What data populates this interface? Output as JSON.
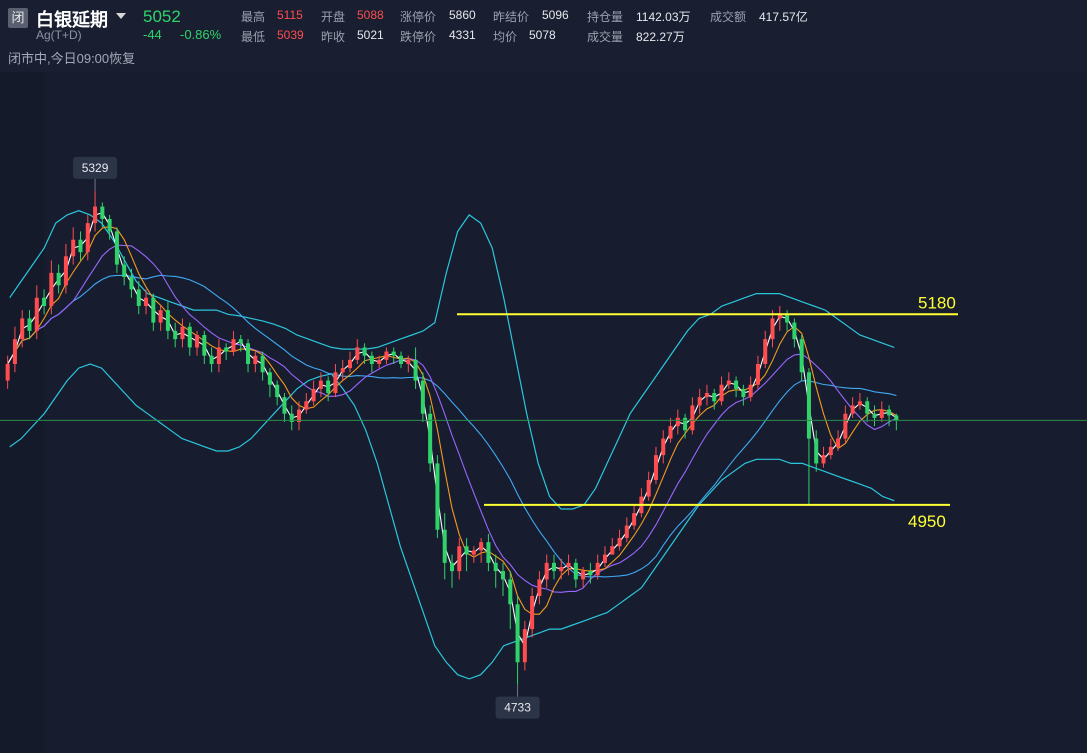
{
  "header": {
    "badge": "闭",
    "name": "白银延期",
    "code": "Ag(T+D)",
    "price": "5052",
    "change": "-44",
    "change_pct": "-0.86%",
    "status": "闭市中,今日09:00恢复",
    "colors": {
      "up": "#ff4d4f",
      "down": "#2fd36a",
      "bg": "#171d2e"
    },
    "icons": {
      "dropdown": "chevron-down-icon"
    }
  },
  "quotes": [
    {
      "label": "最高",
      "value": "5115",
      "color": "red"
    },
    {
      "label": "开盘",
      "value": "5088",
      "color": "red"
    },
    {
      "label": "涨停价",
      "value": "5860",
      "color": "white"
    },
    {
      "label": "昨结价",
      "value": "5096",
      "color": "white"
    },
    {
      "label": "持仓量",
      "value": "1142.03万",
      "color": "white"
    },
    {
      "label": "成交额",
      "value": "417.57亿",
      "color": "white"
    },
    {
      "label": "最低",
      "value": "5039",
      "color": "red"
    },
    {
      "label": "昨收",
      "value": "5021",
      "color": "white"
    },
    {
      "label": "跌停价",
      "value": "4331",
      "color": "white"
    },
    {
      "label": "均价",
      "value": "5078",
      "color": "white"
    },
    {
      "label": "成交量",
      "value": "822.27万",
      "color": "white"
    }
  ],
  "chart_data": {
    "type": "candlestick",
    "ylim": [
      4700,
      5400
    ],
    "grid": false,
    "high_marker": "5329",
    "low_marker": "4733",
    "horizontal_lines": [
      {
        "label": "5180",
        "value": 5180,
        "color": "#ffff33"
      },
      {
        "label": "4950",
        "value": 4950,
        "color": "#ffff33"
      }
    ],
    "reference_line": {
      "value": 5052,
      "color": "#2e8b4a"
    },
    "overlays": [
      "bollinger-upper",
      "bollinger-lower",
      "ma-white",
      "ma-orange",
      "ma-purple",
      "ma-blue"
    ],
    "series_colors": {
      "ma-white": "#ffffff",
      "ma-orange": "#f39a1e",
      "ma-purple": "#9966ff",
      "ma-blue": "#3fa9f5",
      "bollinger": "#2bc6dd"
    },
    "close": [
      5120,
      5150,
      5175,
      5160,
      5200,
      5190,
      5230,
      5215,
      5250,
      5270,
      5255,
      5290,
      5310,
      5295,
      5280,
      5240,
      5225,
      5210,
      5190,
      5200,
      5170,
      5185,
      5160,
      5150,
      5165,
      5140,
      5155,
      5130,
      5120,
      5140,
      5135,
      5150,
      5145,
      5120,
      5130,
      5110,
      5095,
      5080,
      5060,
      5050,
      5065,
      5075,
      5090,
      5100,
      5085,
      5110,
      5115,
      5125,
      5140,
      5130,
      5120,
      5125,
      5135,
      5130,
      5120,
      5125,
      5100,
      5060,
      5000,
      4920,
      4880,
      4870,
      4900,
      4890,
      4895,
      4905,
      4880,
      4870,
      4860,
      4830,
      4760,
      4800,
      4840,
      4860,
      4880,
      4870,
      4875,
      4880,
      4860,
      4870,
      4865,
      4880,
      4890,
      4900,
      4910,
      4925,
      4940,
      4960,
      4980,
      5010,
      5030,
      5045,
      5055,
      5040,
      5070,
      5080,
      5085,
      5075,
      5095,
      5100,
      5090,
      5080,
      5095,
      5120,
      5150,
      5175,
      5180,
      5170,
      5150,
      5110,
      5030,
      5000,
      5010,
      5020,
      5030,
      5060,
      5070,
      5075,
      5060,
      5055,
      5065,
      5058,
      5052
    ],
    "open": [
      5100,
      5120,
      5150,
      5175,
      5160,
      5200,
      5190,
      5230,
      5215,
      5250,
      5270,
      5255,
      5290,
      5310,
      5295,
      5280,
      5240,
      5225,
      5210,
      5190,
      5200,
      5170,
      5185,
      5160,
      5150,
      5165,
      5140,
      5155,
      5130,
      5120,
      5140,
      5135,
      5150,
      5145,
      5120,
      5130,
      5110,
      5095,
      5080,
      5060,
      5050,
      5065,
      5075,
      5090,
      5100,
      5085,
      5110,
      5115,
      5125,
      5140,
      5130,
      5120,
      5125,
      5135,
      5130,
      5120,
      5125,
      5100,
      5060,
      5000,
      4920,
      4880,
      4870,
      4900,
      4890,
      4895,
      4905,
      4880,
      4870,
      4860,
      4830,
      4760,
      4800,
      4840,
      4860,
      4880,
      4870,
      4875,
      4880,
      4860,
      4870,
      4865,
      4880,
      4890,
      4900,
      4910,
      4925,
      4940,
      4960,
      4980,
      5010,
      5030,
      5045,
      5055,
      5040,
      5070,
      5080,
      5085,
      5075,
      5095,
      5100,
      5090,
      5080,
      5095,
      5120,
      5150,
      5175,
      5180,
      5170,
      5150,
      5110,
      5030,
      5000,
      5010,
      5020,
      5030,
      5060,
      5070,
      5075,
      5060,
      5055,
      5065,
      5058
    ],
    "high": [
      5130,
      5165,
      5185,
      5185,
      5215,
      5210,
      5245,
      5240,
      5265,
      5285,
      5280,
      5300,
      5329,
      5315,
      5300,
      5285,
      5250,
      5235,
      5220,
      5210,
      5205,
      5190,
      5195,
      5170,
      5175,
      5170,
      5160,
      5160,
      5140,
      5150,
      5145,
      5160,
      5155,
      5150,
      5135,
      5135,
      5115,
      5100,
      5085,
      5070,
      5075,
      5085,
      5100,
      5110,
      5105,
      5120,
      5125,
      5135,
      5150,
      5145,
      5135,
      5130,
      5140,
      5140,
      5135,
      5130,
      5140,
      5110,
      5070,
      5010,
      4940,
      4890,
      4910,
      4910,
      4900,
      4910,
      4915,
      4890,
      4880,
      4870,
      4840,
      4810,
      4850,
      4870,
      4890,
      4890,
      4885,
      4890,
      4885,
      4875,
      4880,
      4890,
      4900,
      4910,
      4920,
      4935,
      4950,
      4970,
      4990,
      5020,
      5040,
      5055,
      5065,
      5060,
      5080,
      5090,
      5095,
      5090,
      5105,
      5110,
      5105,
      5095,
      5105,
      5130,
      5160,
      5185,
      5190,
      5185,
      5175,
      5155,
      5115,
      5040,
      5020,
      5030,
      5040,
      5070,
      5080,
      5085,
      5080,
      5070,
      5075,
      5070,
      5060
    ],
    "low": [
      5090,
      5110,
      5140,
      5150,
      5150,
      5180,
      5180,
      5205,
      5205,
      5240,
      5245,
      5245,
      5280,
      5285,
      5270,
      5230,
      5215,
      5200,
      5180,
      5180,
      5160,
      5160,
      5150,
      5140,
      5140,
      5130,
      5130,
      5120,
      5110,
      5110,
      5125,
      5130,
      5135,
      5110,
      5110,
      5100,
      5080,
      5070,
      5050,
      5040,
      5040,
      5060,
      5070,
      5080,
      5075,
      5080,
      5100,
      5110,
      5120,
      5120,
      5110,
      5115,
      5120,
      5120,
      5115,
      5110,
      5090,
      5050,
      4990,
      4910,
      4860,
      4850,
      4860,
      4870,
      4880,
      4880,
      4870,
      4850,
      4840,
      4800,
      4733,
      4750,
      4790,
      4830,
      4850,
      4860,
      4860,
      4865,
      4850,
      4850,
      4855,
      4860,
      4875,
      4890,
      4895,
      4905,
      4920,
      4935,
      4955,
      4975,
      5000,
      5025,
      5035,
      5030,
      5035,
      5060,
      5070,
      5065,
      5070,
      5090,
      5080,
      5070,
      5075,
      5090,
      5115,
      5140,
      5160,
      5160,
      5140,
      5100,
      4950,
      4990,
      4995,
      5005,
      5015,
      5025,
      5055,
      5065,
      5050,
      5045,
      5050,
      5045,
      5040
    ],
    "boll_upper": [
      5200,
      5220,
      5240,
      5260,
      5290,
      5300,
      5305,
      5300,
      5290,
      5270,
      5245,
      5220,
      5205,
      5200,
      5195,
      5190,
      5185,
      5185,
      5185,
      5180,
      5178,
      5175,
      5172,
      5168,
      5163,
      5155,
      5150,
      5145,
      5140,
      5138,
      5138,
      5138,
      5140,
      5145,
      5150,
      5155,
      5160,
      5170,
      5230,
      5280,
      5300,
      5290,
      5260,
      5200,
      5130,
      5060,
      5000,
      4960,
      4945,
      4945,
      4950,
      4970,
      5000,
      5030,
      5060,
      5080,
      5100,
      5120,
      5140,
      5160,
      5175,
      5180,
      5190,
      5195,
      5200,
      5205,
      5205,
      5205,
      5200,
      5195,
      5190,
      5185,
      5175,
      5165,
      5155,
      5150,
      5145,
      5140
    ],
    "boll_lower": [
      5020,
      5030,
      5045,
      5060,
      5080,
      5100,
      5115,
      5120,
      5115,
      5100,
      5085,
      5070,
      5060,
      5050,
      5040,
      5030,
      5025,
      5020,
      5015,
      5015,
      5020,
      5030,
      5045,
      5060,
      5075,
      5090,
      5100,
      5105,
      5108,
      5090,
      5070,
      5040,
      5000,
      4950,
      4900,
      4860,
      4820,
      4780,
      4760,
      4745,
      4740,
      4745,
      4760,
      4780,
      4785,
      4790,
      4795,
      4800,
      4800,
      4805,
      4810,
      4815,
      4820,
      4830,
      4840,
      4850,
      4870,
      4890,
      4910,
      4930,
      4950,
      4965,
      4980,
      4990,
      5000,
      5005,
      5005,
      5005,
      5000,
      5000,
      4995,
      4990,
      4985,
      4980,
      4975,
      4970,
      4960,
      4955
    ]
  }
}
